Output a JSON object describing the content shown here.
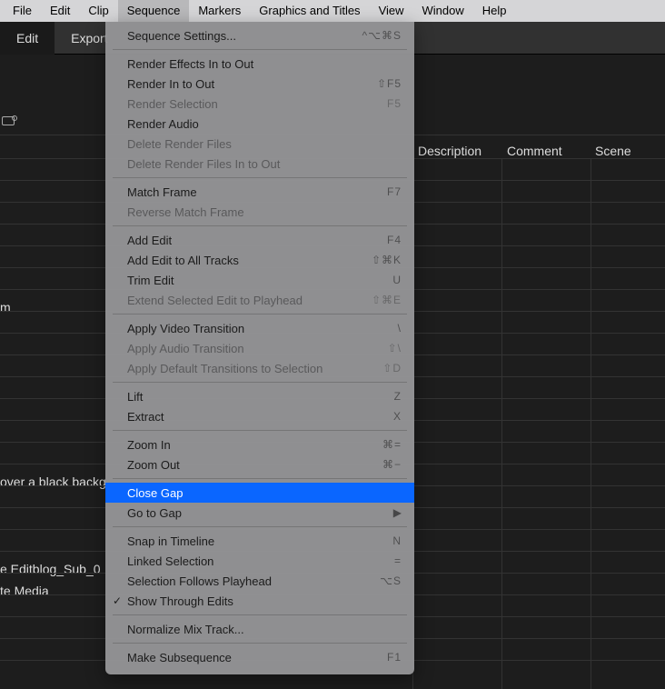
{
  "menubar": {
    "items": [
      "File",
      "Edit",
      "Clip",
      "Sequence",
      "Markers",
      "Graphics and Titles",
      "View",
      "Window",
      "Help"
    ],
    "active": "Sequence"
  },
  "appbar": {
    "tabs": [
      "Edit",
      "Export"
    ],
    "selected": "Edit"
  },
  "columns": {
    "c1": "Description",
    "c2": "Comment",
    "c3": "Scene"
  },
  "bgtext": {
    "t1": "m",
    "t2": "over a black backg",
    "t3": "e Editblog_Sub_0",
    "t4": "te Media"
  },
  "dropdown": {
    "groups": [
      [
        {
          "label": "Sequence Settings...",
          "sc": "^⌥⌘S",
          "enabled": true
        }
      ],
      [
        {
          "label": "Render Effects In to Out",
          "sc": "",
          "enabled": true
        },
        {
          "label": "Render In to Out",
          "sc": "⇧F5",
          "enabled": true
        },
        {
          "label": "Render Selection",
          "sc": "F5",
          "enabled": false
        },
        {
          "label": "Render Audio",
          "sc": "",
          "enabled": true
        },
        {
          "label": "Delete Render Files",
          "sc": "",
          "enabled": false
        },
        {
          "label": "Delete Render Files In to Out",
          "sc": "",
          "enabled": false
        }
      ],
      [
        {
          "label": "Match Frame",
          "sc": "F7",
          "enabled": true
        },
        {
          "label": "Reverse Match Frame",
          "sc": "",
          "enabled": false
        }
      ],
      [
        {
          "label": "Add Edit",
          "sc": "F4",
          "enabled": true
        },
        {
          "label": "Add Edit to All Tracks",
          "sc": "⇧⌘K",
          "enabled": true
        },
        {
          "label": "Trim Edit",
          "sc": "U",
          "enabled": true
        },
        {
          "label": "Extend Selected Edit to Playhead",
          "sc": "⇧⌘E",
          "enabled": false
        }
      ],
      [
        {
          "label": "Apply Video Transition",
          "sc": "\\",
          "enabled": true
        },
        {
          "label": "Apply Audio Transition",
          "sc": "⇧\\",
          "enabled": false
        },
        {
          "label": "Apply Default Transitions to Selection",
          "sc": "⇧D",
          "enabled": false
        }
      ],
      [
        {
          "label": "Lift",
          "sc": "Z",
          "enabled": true
        },
        {
          "label": "Extract",
          "sc": "X",
          "enabled": true
        }
      ],
      [
        {
          "label": "Zoom In",
          "sc": "⌘=",
          "enabled": true
        },
        {
          "label": "Zoom Out",
          "sc": "⌘−",
          "enabled": true
        }
      ],
      [
        {
          "label": "Close Gap",
          "sc": "",
          "enabled": true,
          "highlight": true
        },
        {
          "label": "Go to Gap",
          "sc": "",
          "enabled": true,
          "submenu": true
        }
      ],
      [
        {
          "label": "Snap in Timeline",
          "sc": "N",
          "enabled": true
        },
        {
          "label": "Linked Selection",
          "sc": "=",
          "enabled": true
        },
        {
          "label": "Selection Follows Playhead",
          "sc": "⌥S",
          "enabled": true
        },
        {
          "label": "Show Through Edits",
          "sc": "",
          "enabled": true,
          "checked": true
        }
      ],
      [
        {
          "label": "Normalize Mix Track...",
          "sc": "",
          "enabled": true
        }
      ],
      [
        {
          "label": "Make Subsequence",
          "sc": "F1",
          "enabled": true
        }
      ]
    ]
  }
}
